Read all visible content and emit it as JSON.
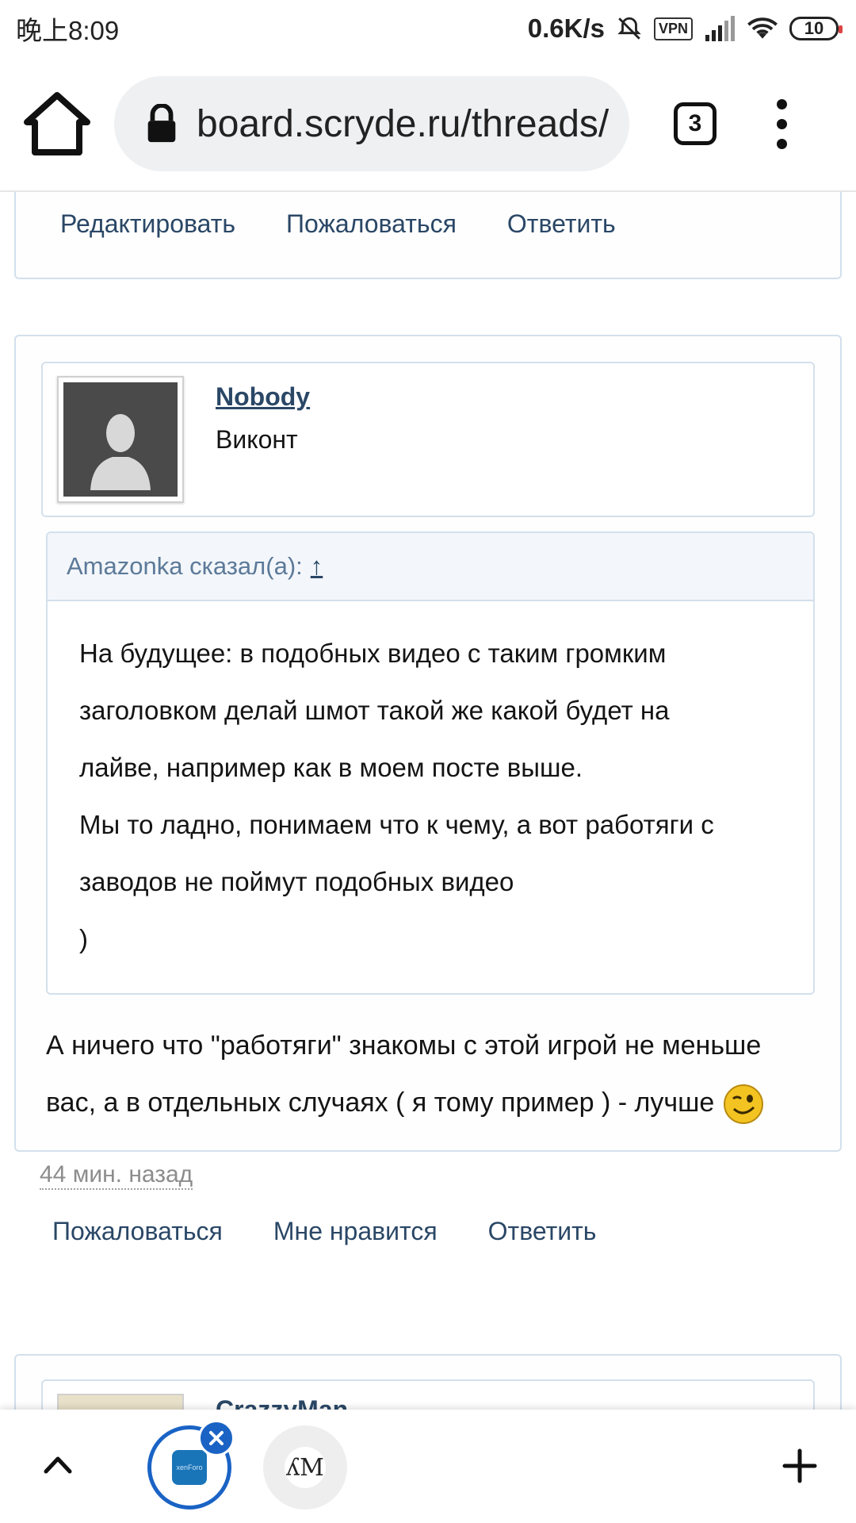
{
  "status_bar": {
    "time": "晚上8:09",
    "net_speed": "0.6K/s",
    "vpn": "VPN",
    "battery": "10"
  },
  "browser": {
    "url": "board.scryde.ru/threads/",
    "tab_count": "3",
    "icons": [
      "home-icon",
      "lock-icon",
      "tabs-icon",
      "overflow-menu-icon"
    ]
  },
  "prev_post_actions": {
    "edit": "Редактировать",
    "report": "Пожаловаться",
    "reply": "Ответить"
  },
  "post": {
    "username": "Nobody",
    "user_title": "Виконт",
    "quote": {
      "header": "Amazonka сказал(а):",
      "jump": "↑",
      "lines": [
        "На будущее: в подобных видео с таким громким",
        "заголовком делай шмот такой же какой будет на",
        "лайве, например как в моем посте выше.",
        "Мы то ладно, понимаем что к чему, а вот работяги с",
        "заводов не поймут подобных видео",
        ")"
      ]
    },
    "message_line1": "А ничего что \"работяги\" знакомы с этой игрой не меньше",
    "message_line2": "вас, а в отдельных случаях ( я тому пример ) - лучше",
    "timestamp": "44 мин. назад",
    "actions": {
      "report": "Пожаловаться",
      "like": "Мне нравится",
      "reply": "Ответить"
    }
  },
  "next_post": {
    "username": "CrazzyMan"
  },
  "bottom_bar": {
    "active_tab_label": "xenForo",
    "second_tab_label": "ʎM"
  }
}
